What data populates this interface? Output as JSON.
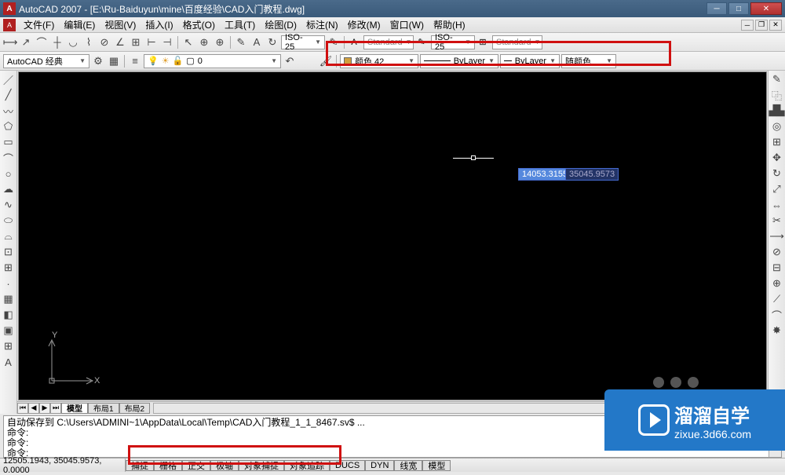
{
  "titlebar": {
    "app_icon": "A",
    "title": "AutoCAD 2007 - [E:\\Ru-Baiduyun\\mine\\百度经验\\CAD入门教程.dwg]"
  },
  "menu": {
    "items": [
      "文件(F)",
      "编辑(E)",
      "视图(V)",
      "插入(I)",
      "格式(O)",
      "工具(T)",
      "绘图(D)",
      "标注(N)",
      "修改(M)",
      "窗口(W)",
      "帮助(H)"
    ]
  },
  "tb1": {
    "dim1": "ISO-25",
    "dim2": "ISO-25",
    "std1": "Standard",
    "std2": "Standard"
  },
  "tb2": {
    "workspace": "AutoCAD 经典",
    "layer": "0",
    "color_label": "颜色 42",
    "linetype": "ByLayer",
    "lineweight": "ByLayer",
    "plotstyle": "随颜色"
  },
  "canvas": {
    "dyn1": "14053.3155",
    "dyn2": "35045.9573",
    "ucs_y": "Y",
    "ucs_x": "X"
  },
  "tabs": {
    "model": "模型",
    "layout1": "布局1",
    "layout2": "布局2"
  },
  "cmd": {
    "line1": "自动保存到 C:\\Users\\ADMINI~1\\AppData\\Local\\Temp\\CAD入门教程_1_1_8467.sv$ ...",
    "line2": "命令:",
    "line3": "命令:",
    "prompt": "命令:"
  },
  "status": {
    "coords": "12505.1943, 35045.9573, 0.0000",
    "buttons": [
      "捕捉",
      "栅格",
      "正交",
      "极轴",
      "对象捕捉",
      "对象追踪",
      "DUCS",
      "DYN",
      "线宽",
      "模型"
    ]
  },
  "watermark": {
    "brand": "溜溜自学",
    "url": "zixue.3d66.com"
  }
}
